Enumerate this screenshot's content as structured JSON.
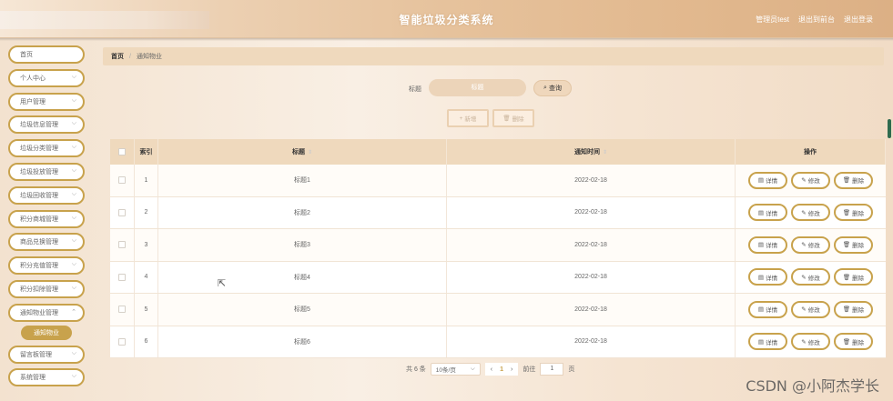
{
  "header": {
    "title": "智能垃圾分类系统",
    "links": [
      "管理员test",
      "退出到前台",
      "退出登录"
    ]
  },
  "sidebar": {
    "items": [
      {
        "label": "首页",
        "chevron": false
      },
      {
        "label": "个人中心",
        "chevron": true
      },
      {
        "label": "用户管理",
        "chevron": true
      },
      {
        "label": "垃圾信息管理",
        "chevron": true
      },
      {
        "label": "垃圾分类管理",
        "chevron": true
      },
      {
        "label": "垃圾投放管理",
        "chevron": true
      },
      {
        "label": "垃圾回收管理",
        "chevron": true
      },
      {
        "label": "积分商城管理",
        "chevron": true
      },
      {
        "label": "商品兑换管理",
        "chevron": true
      },
      {
        "label": "积分充值管理",
        "chevron": true
      },
      {
        "label": "积分扣除管理",
        "chevron": true
      },
      {
        "label": "通知物业管理",
        "chevron": true
      }
    ],
    "active_sub": "通知物业",
    "bottom_items": [
      {
        "label": "留言板管理",
        "chevron": true
      },
      {
        "label": "系统管理",
        "chevron": true
      }
    ]
  },
  "breadcrumb": {
    "home": "首页",
    "current": "通知物业"
  },
  "search": {
    "label": "标题",
    "placeholder": "标题",
    "button": "查询"
  },
  "actions": {
    "add": "新增",
    "delete": "删除"
  },
  "table": {
    "headers": {
      "index": "索引",
      "title": "标题",
      "time": "通知时间",
      "ops": "操作"
    },
    "rows": [
      {
        "index": "1",
        "title": "标题1",
        "time": "2022-02-18"
      },
      {
        "index": "2",
        "title": "标题2",
        "time": "2022-02-18"
      },
      {
        "index": "3",
        "title": "标题3",
        "time": "2022-02-18"
      },
      {
        "index": "4",
        "title": "标题4",
        "time": "2022-02-18"
      },
      {
        "index": "5",
        "title": "标题5",
        "time": "2022-02-18"
      },
      {
        "index": "6",
        "title": "标题6",
        "time": "2022-02-18"
      }
    ],
    "op_labels": {
      "detail": "详情",
      "edit": "修改",
      "delete": "删除"
    }
  },
  "pagination": {
    "total": "共 6 条",
    "page_size": "10条/页",
    "current_page": "1",
    "goto_label": "前往",
    "goto_value": "1",
    "page_suffix": "页"
  },
  "watermark": "CSDN @小阿杰学长",
  "colors": {
    "accent": "#c8a24c",
    "header_bg": "#e6c29c",
    "table_head": "#efd9bd"
  }
}
